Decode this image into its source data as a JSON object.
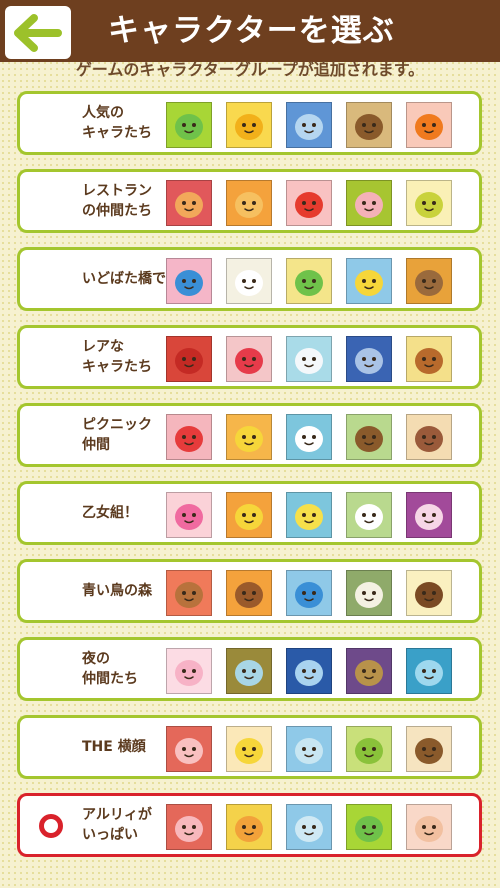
{
  "header": {
    "title": "キャラクターを選ぶ",
    "back_icon": "arrow-left-icon"
  },
  "subtitle": "ゲームのキャラクターグループが追加されます。",
  "groups": [
    {
      "label": "人気の\nキャラたち",
      "selected": false,
      "characters": [
        {
          "name": "frog-icon",
          "bg": "#a8d636",
          "color": "#6fc24a"
        },
        {
          "name": "chick-person-icon",
          "bg": "#f9d94e",
          "color": "#f2b01a"
        },
        {
          "name": "ghost-icon",
          "bg": "#5f96d6",
          "color": "#b5d6f0"
        },
        {
          "name": "chestnut-icon",
          "bg": "#d9b97c",
          "color": "#8a5a2b"
        },
        {
          "name": "pumpkin-icon",
          "bg": "#f9c9b9",
          "color": "#f07a1e"
        }
      ]
    },
    {
      "label": "レストラン\nの仲間たち",
      "selected": false,
      "characters": [
        {
          "name": "donut-icon",
          "bg": "#e1585b",
          "color": "#f2a85a"
        },
        {
          "name": "toast-icon",
          "bg": "#f4a23c",
          "color": "#f6c060"
        },
        {
          "name": "tomato-icon",
          "bg": "#f9c2c2",
          "color": "#e63b2e"
        },
        {
          "name": "pig-chef-icon",
          "bg": "#a7c531",
          "color": "#f4b1b8"
        },
        {
          "name": "bean-icon",
          "bg": "#faf0b6",
          "color": "#c9d23c"
        }
      ]
    },
    {
      "label": "いどばた橋で",
      "selected": false,
      "characters": [
        {
          "name": "fish-icon",
          "bg": "#f5b6c8",
          "color": "#3a8fd6"
        },
        {
          "name": "glasses-face-icon",
          "bg": "#f4f1e2",
          "color": "#ffffff"
        },
        {
          "name": "frog-float-icon",
          "bg": "#f4e58a",
          "color": "#6fc24a"
        },
        {
          "name": "duck-icon",
          "bg": "#8fc9e8",
          "color": "#f6d63a"
        },
        {
          "name": "dinosaur-icon",
          "bg": "#e8a23a",
          "color": "#9a6a3c"
        }
      ]
    },
    {
      "label": "レアな\nキャラたち",
      "selected": false,
      "characters": [
        {
          "name": "ladybug-icon",
          "bg": "#d9463a",
          "color": "#c42a24"
        },
        {
          "name": "cherry-icon",
          "bg": "#f4c6c8",
          "color": "#e63b4a"
        },
        {
          "name": "jellyfish-icon",
          "bg": "#a9dbe8",
          "color": "#f4f8fb"
        },
        {
          "name": "elephant-icon",
          "bg": "#3a64b3",
          "color": "#a9c3e6"
        },
        {
          "name": "curly-hair-girl-icon",
          "bg": "#f4e08a",
          "color": "#b86a2c"
        }
      ]
    },
    {
      "label": "ピクニック\n仲間",
      "selected": false,
      "characters": [
        {
          "name": "strawberry-icon",
          "bg": "#f5b6bd",
          "color": "#e63b3b"
        },
        {
          "name": "chick-person-icon",
          "bg": "#f6b64a",
          "color": "#f6d63a"
        },
        {
          "name": "mug-icon",
          "bg": "#7dc6dd",
          "color": "#ffffff"
        },
        {
          "name": "chestnut-icon",
          "bg": "#b9d98e",
          "color": "#8a5a2b"
        },
        {
          "name": "almond-icon",
          "bg": "#f4dcb2",
          "color": "#9a5a3a"
        }
      ]
    },
    {
      "label": "乙女組！",
      "selected": false,
      "characters": [
        {
          "name": "flower-icon",
          "bg": "#fbd2d8",
          "color": "#f06aa0"
        },
        {
          "name": "chick-icon",
          "bg": "#f4a23c",
          "color": "#f6d63a"
        },
        {
          "name": "puffer-bird-icon",
          "bg": "#7dc6dd",
          "color": "#f6e04a"
        },
        {
          "name": "rabbit-icon",
          "bg": "#b9d98e",
          "color": "#ffffff"
        },
        {
          "name": "heart-face-icon",
          "bg": "#a24a9a",
          "color": "#f6d6e6"
        }
      ]
    },
    {
      "label": "青い鳥の森",
      "selected": false,
      "characters": [
        {
          "name": "monkey-icon",
          "bg": "#f07a5a",
          "color": "#b8723c"
        },
        {
          "name": "bear-icon",
          "bg": "#f4a23c",
          "color": "#9a5a2b"
        },
        {
          "name": "blue-bird-icon",
          "bg": "#8fc9e8",
          "color": "#3a8fd6"
        },
        {
          "name": "sheep-icon",
          "bg": "#8faa6a",
          "color": "#f4f1e2"
        },
        {
          "name": "acorn-icon",
          "bg": "#faf0c0",
          "color": "#7a4a24"
        }
      ]
    },
    {
      "label": "夜の\n仲間たち",
      "selected": false,
      "characters": [
        {
          "name": "star-icon",
          "bg": "#fcdce4",
          "color": "#f7b2c6"
        },
        {
          "name": "ufo-icon",
          "bg": "#9a8a3a",
          "color": "#a8d6e6"
        },
        {
          "name": "ghost-icon",
          "bg": "#2a5aa8",
          "color": "#a9d3ef"
        },
        {
          "name": "owl-icon",
          "bg": "#6e4a8a",
          "color": "#b8924a"
        },
        {
          "name": "alien-icon",
          "bg": "#3aa0c8",
          "color": "#9ed8ee"
        }
      ]
    },
    {
      "label": "THE 横顔",
      "selected": false,
      "characters": [
        {
          "name": "pig-profile-icon",
          "bg": "#e4685a",
          "color": "#f9c0c0"
        },
        {
          "name": "chick-profile-icon",
          "bg": "#fbe8b8",
          "color": "#f6d63a"
        },
        {
          "name": "alien-profile-icon",
          "bg": "#8fc9e8",
          "color": "#c8e6f2"
        },
        {
          "name": "frog-profile-icon",
          "bg": "#c9e07a",
          "color": "#8ac23a"
        },
        {
          "name": "chestnut-profile-icon",
          "bg": "#f6e4c0",
          "color": "#8a5a2b"
        }
      ]
    },
    {
      "label": "アルリィが\nいっぱい",
      "selected": true,
      "characters": [
        {
          "name": "pig-face-icon",
          "bg": "#e4685a",
          "color": "#f8b8bc"
        },
        {
          "name": "orange-face-icon",
          "bg": "#f4d24a",
          "color": "#f2a23a"
        },
        {
          "name": "blue-face-icon",
          "bg": "#8fc9e8",
          "color": "#cfe9f4"
        },
        {
          "name": "green-face-icon",
          "bg": "#a8d636",
          "color": "#6fc24a"
        },
        {
          "name": "beige-face-icon",
          "bg": "#f9d8c8",
          "color": "#f2c0a0"
        }
      ]
    }
  ]
}
